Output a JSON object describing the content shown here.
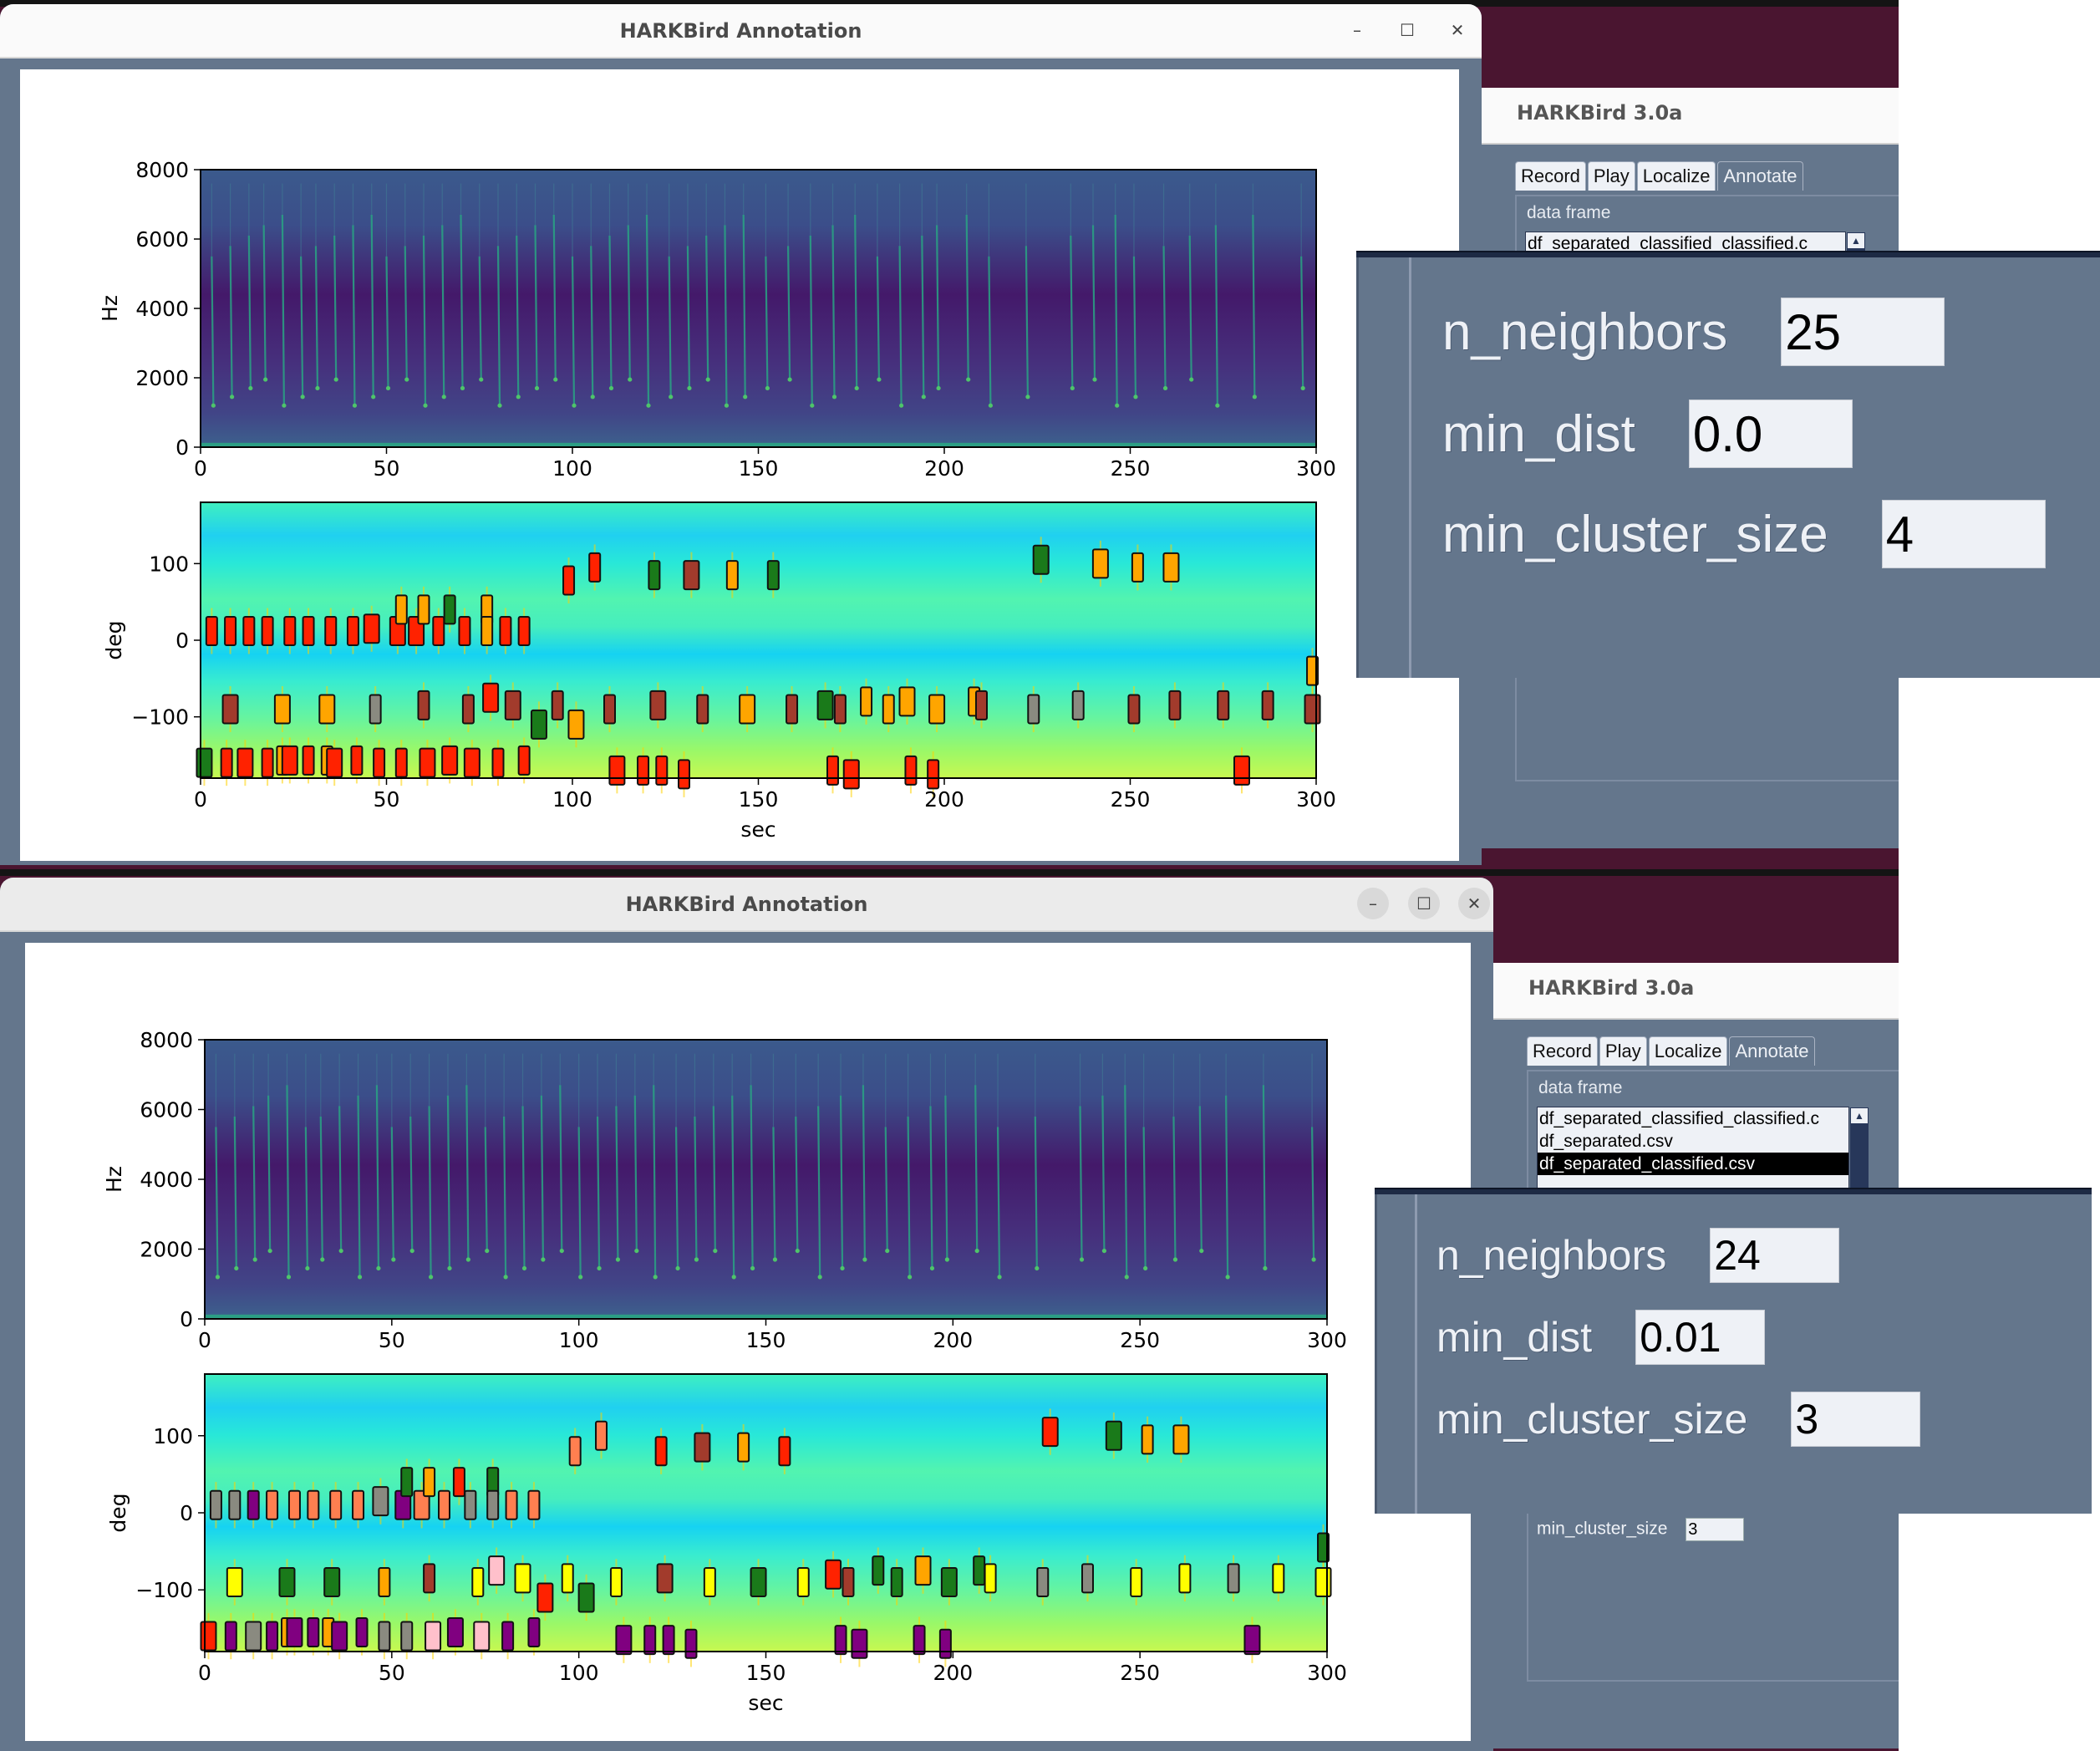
{
  "desktop": {
    "background": "#4a1530"
  },
  "windows": [
    {
      "title": "HARKBird Annotation",
      "controls": {
        "minimize": "–",
        "maximize": "☐",
        "close": "✕"
      }
    },
    {
      "title": "HARKBird Annotation",
      "controls": {
        "minimize": "–",
        "maximize": "☐",
        "close": "✕"
      }
    }
  ],
  "app_panels": [
    {
      "title": "HARKBird 3.0a",
      "tabs": [
        "Record",
        "Play",
        "Localize",
        "Annotate"
      ],
      "active_tab": "Annotate",
      "data_frame_label": "data frame",
      "data_frames": [
        "df_separated_classified_classified.c"
      ],
      "selected_data_frame": null
    },
    {
      "title": "HARKBird 3.0a",
      "tabs": [
        "Record",
        "Play",
        "Localize",
        "Annotate"
      ],
      "active_tab": "Annotate",
      "data_frame_label": "data frame",
      "data_frames": [
        "df_separated_classified_classified.c",
        "df_separated.csv",
        "df_separated_classified.csv"
      ],
      "selected_data_frame": "df_separated_classified.csv",
      "min_cluster_size_label": "min_cluster_size",
      "min_cluster_size_value": "3"
    }
  ],
  "parameter_overlays": [
    {
      "params": [
        {
          "label": "n_neighbors",
          "value": "25"
        },
        {
          "label": "min_dist",
          "value": "0.0"
        },
        {
          "label": "min_cluster_size",
          "value": "4"
        }
      ]
    },
    {
      "params": [
        {
          "label": "n_neighbors",
          "value": "24"
        },
        {
          "label": "min_dist",
          "value": "0.01"
        },
        {
          "label": "min_cluster_size",
          "value": "3"
        }
      ]
    }
  ],
  "colors": {
    "red": "#ff2200",
    "brown": "#a23b2c",
    "orange": "#ffa500",
    "green": "#1a7a1a",
    "gray": "#8a8a80",
    "purple": "#800080",
    "coral": "#ff7f50",
    "yellow": "#ffff00",
    "pink": "#ffc0cb"
  },
  "chart_data": [
    {
      "type": "heatmap",
      "title": "",
      "panel": "top-spectrogram",
      "xlabel": "",
      "ylabel": "Hz",
      "xlim": [
        0,
        300
      ],
      "ylim": [
        0,
        8000
      ],
      "xticks": [
        "0",
        "50",
        "100",
        "150",
        "200",
        "250",
        "300"
      ],
      "yticks": [
        "0",
        "2000",
        "4000",
        "6000",
        "8000"
      ],
      "colormap": "viridis",
      "call_times": [
        3,
        8,
        13,
        17,
        22,
        27,
        31,
        36,
        41,
        46,
        50,
        55,
        60,
        65,
        70,
        75,
        80,
        85,
        90,
        95,
        100,
        105,
        110,
        115,
        120,
        126,
        131,
        136,
        141,
        146,
        152,
        158,
        164,
        170,
        176,
        182,
        188,
        194,
        198,
        206,
        212,
        222,
        234,
        240,
        246,
        251,
        259,
        266,
        273,
        283,
        296
      ]
    },
    {
      "type": "scatter",
      "panel": "top-doa",
      "xlabel": "sec",
      "ylabel": "deg",
      "xlim": [
        0,
        300
      ],
      "ylim": [
        -180,
        180
      ],
      "xticks": [
        "0",
        "50",
        "100",
        "150",
        "200",
        "250",
        "300"
      ],
      "yticks": [
        "−100",
        "0",
        "100"
      ],
      "colormap": "jet",
      "points": [
        [
          1,
          -160,
          "green"
        ],
        [
          3,
          12,
          "red"
        ],
        [
          8,
          12,
          "red"
        ],
        [
          8,
          -90,
          "brown"
        ],
        [
          7,
          -160,
          "red"
        ],
        [
          13,
          12,
          "red"
        ],
        [
          12,
          -160,
          "red"
        ],
        [
          18,
          12,
          "red"
        ],
        [
          18,
          -160,
          "red"
        ],
        [
          22,
          -90,
          "orange"
        ],
        [
          22,
          -157,
          "orange"
        ],
        [
          24,
          12,
          "red"
        ],
        [
          24,
          -157,
          "red"
        ],
        [
          29,
          12,
          "red"
        ],
        [
          29,
          -157,
          "red"
        ],
        [
          34,
          -90,
          "orange"
        ],
        [
          34,
          -157,
          "orange"
        ],
        [
          35,
          12,
          "red"
        ],
        [
          36,
          -160,
          "red"
        ],
        [
          41,
          12,
          "red"
        ],
        [
          42,
          -157,
          "red"
        ],
        [
          46,
          15,
          "red"
        ],
        [
          47,
          -90,
          "gray"
        ],
        [
          48,
          -160,
          "red"
        ],
        [
          53,
          12,
          "red"
        ],
        [
          54,
          40,
          "orange"
        ],
        [
          54,
          -160,
          "red"
        ],
        [
          58,
          12,
          "red"
        ],
        [
          60,
          40,
          "orange"
        ],
        [
          60,
          -85,
          "brown"
        ],
        [
          61,
          -160,
          "red"
        ],
        [
          64,
          12,
          "red"
        ],
        [
          67,
          40,
          "green"
        ],
        [
          67,
          -157,
          "red"
        ],
        [
          71,
          12,
          "red"
        ],
        [
          72,
          -90,
          "brown"
        ],
        [
          73,
          -160,
          "red"
        ],
        [
          77,
          40,
          "orange"
        ],
        [
          77,
          12,
          "orange"
        ],
        [
          78,
          -75,
          "red"
        ],
        [
          80,
          -160,
          "red"
        ],
        [
          82,
          12,
          "red"
        ],
        [
          84,
          -85,
          "brown"
        ],
        [
          87,
          12,
          "red"
        ],
        [
          87,
          -157,
          "red"
        ],
        [
          91,
          -110,
          "green"
        ],
        [
          96,
          -85,
          "brown"
        ],
        [
          99,
          78,
          "red"
        ],
        [
          101,
          -110,
          "orange"
        ],
        [
          106,
          95,
          "red"
        ],
        [
          110,
          -90,
          "brown"
        ],
        [
          112,
          -170,
          "red"
        ],
        [
          119,
          -170,
          "red"
        ],
        [
          122,
          85,
          "green"
        ],
        [
          123,
          -85,
          "brown"
        ],
        [
          124,
          -170,
          "red"
        ],
        [
          130,
          -175,
          "red"
        ],
        [
          132,
          85,
          "brown"
        ],
        [
          135,
          -90,
          "brown"
        ],
        [
          143,
          85,
          "orange"
        ],
        [
          147,
          -90,
          "orange"
        ],
        [
          154,
          85,
          "green"
        ],
        [
          159,
          -90,
          "brown"
        ],
        [
          168,
          -85,
          "green"
        ],
        [
          170,
          -170,
          "red"
        ],
        [
          172,
          -90,
          "brown"
        ],
        [
          175,
          -175,
          "red"
        ],
        [
          179,
          -80,
          "orange"
        ],
        [
          185,
          -90,
          "orange"
        ],
        [
          190,
          -80,
          "orange"
        ],
        [
          191,
          -170,
          "red"
        ],
        [
          197,
          -175,
          "red"
        ],
        [
          198,
          -90,
          "orange"
        ],
        [
          208,
          -80,
          "orange"
        ],
        [
          210,
          -85,
          "brown"
        ],
        [
          226,
          105,
          "green"
        ],
        [
          224,
          -90,
          "gray"
        ],
        [
          236,
          -85,
          "gray"
        ],
        [
          242,
          100,
          "orange"
        ],
        [
          251,
          -90,
          "brown"
        ],
        [
          252,
          95,
          "orange"
        ],
        [
          261,
          95,
          "orange"
        ],
        [
          262,
          -85,
          "brown"
        ],
        [
          275,
          -85,
          "brown"
        ],
        [
          280,
          -170,
          "red"
        ],
        [
          287,
          -85,
          "brown"
        ],
        [
          299,
          -40,
          "orange"
        ],
        [
          299,
          -90,
          "brown"
        ]
      ]
    },
    {
      "type": "heatmap",
      "panel": "bottom-spectrogram",
      "xlabel": "",
      "ylabel": "Hz",
      "xlim": [
        0,
        300
      ],
      "ylim": [
        0,
        8000
      ],
      "xticks": [
        "0",
        "50",
        "100",
        "150",
        "200",
        "250",
        "300"
      ],
      "yticks": [
        "0",
        "2000",
        "4000",
        "6000",
        "8000"
      ],
      "colormap": "viridis",
      "call_times": [
        3,
        8,
        13,
        17,
        22,
        27,
        31,
        36,
        41,
        46,
        50,
        55,
        60,
        65,
        70,
        75,
        80,
        85,
        90,
        95,
        100,
        105,
        110,
        115,
        120,
        126,
        131,
        136,
        141,
        146,
        152,
        158,
        164,
        170,
        176,
        182,
        188,
        194,
        198,
        206,
        212,
        222,
        234,
        240,
        246,
        251,
        259,
        266,
        273,
        283,
        296
      ]
    },
    {
      "type": "scatter",
      "panel": "bottom-doa",
      "xlabel": "sec",
      "ylabel": "deg",
      "xlim": [
        0,
        300
      ],
      "ylim": [
        -180,
        180
      ],
      "xticks": [
        "0",
        "50",
        "100",
        "150",
        "200",
        "250",
        "300"
      ],
      "yticks": [
        "−100",
        "0",
        "100"
      ],
      "colormap": "jet",
      "points": [
        [
          1,
          -160,
          "red"
        ],
        [
          3,
          10,
          "gray"
        ],
        [
          8,
          10,
          "gray"
        ],
        [
          8,
          -90,
          "yellow"
        ],
        [
          7,
          -160,
          "purple"
        ],
        [
          13,
          10,
          "purple"
        ],
        [
          13,
          -160,
          "gray"
        ],
        [
          18,
          10,
          "coral"
        ],
        [
          18,
          -160,
          "purple"
        ],
        [
          22,
          -90,
          "green"
        ],
        [
          22,
          -155,
          "orange"
        ],
        [
          24,
          10,
          "coral"
        ],
        [
          24,
          -155,
          "purple"
        ],
        [
          29,
          10,
          "coral"
        ],
        [
          29,
          -155,
          "purple"
        ],
        [
          34,
          -90,
          "green"
        ],
        [
          33,
          -155,
          "orange"
        ],
        [
          35,
          10,
          "coral"
        ],
        [
          36,
          -160,
          "purple"
        ],
        [
          41,
          10,
          "coral"
        ],
        [
          42,
          -155,
          "purple"
        ],
        [
          47,
          15,
          "gray"
        ],
        [
          48,
          -90,
          "orange"
        ],
        [
          48,
          -160,
          "gray"
        ],
        [
          53,
          10,
          "purple"
        ],
        [
          54,
          40,
          "green"
        ],
        [
          54,
          -160,
          "gray"
        ],
        [
          58,
          10,
          "coral"
        ],
        [
          60,
          40,
          "orange"
        ],
        [
          60,
          -85,
          "brown"
        ],
        [
          61,
          -160,
          "pink"
        ],
        [
          64,
          10,
          "coral"
        ],
        [
          68,
          40,
          "red"
        ],
        [
          67,
          -155,
          "purple"
        ],
        [
          71,
          10,
          "gray"
        ],
        [
          73,
          -90,
          "yellow"
        ],
        [
          74,
          -160,
          "pink"
        ],
        [
          77,
          40,
          "green"
        ],
        [
          77,
          10,
          "gray"
        ],
        [
          78,
          -75,
          "pink"
        ],
        [
          81,
          -160,
          "purple"
        ],
        [
          82,
          10,
          "coral"
        ],
        [
          85,
          -85,
          "yellow"
        ],
        [
          88,
          10,
          "coral"
        ],
        [
          88,
          -155,
          "purple"
        ],
        [
          91,
          -110,
          "red"
        ],
        [
          97,
          -85,
          "yellow"
        ],
        [
          99,
          80,
          "coral"
        ],
        [
          102,
          -110,
          "green"
        ],
        [
          106,
          100,
          "coral"
        ],
        [
          110,
          -90,
          "yellow"
        ],
        [
          112,
          -165,
          "purple"
        ],
        [
          119,
          -165,
          "purple"
        ],
        [
          122,
          80,
          "red"
        ],
        [
          123,
          -85,
          "brown"
        ],
        [
          124,
          -165,
          "purple"
        ],
        [
          130,
          -170,
          "purple"
        ],
        [
          133,
          85,
          "brown"
        ],
        [
          135,
          -90,
          "yellow"
        ],
        [
          144,
          85,
          "orange"
        ],
        [
          148,
          -90,
          "green"
        ],
        [
          155,
          80,
          "red"
        ],
        [
          160,
          -90,
          "yellow"
        ],
        [
          168,
          -80,
          "red"
        ],
        [
          170,
          -165,
          "purple"
        ],
        [
          172,
          -90,
          "brown"
        ],
        [
          175,
          -170,
          "purple"
        ],
        [
          180,
          -75,
          "green"
        ],
        [
          185,
          -90,
          "green"
        ],
        [
          192,
          -75,
          "orange"
        ],
        [
          191,
          -165,
          "purple"
        ],
        [
          198,
          -170,
          "purple"
        ],
        [
          199,
          -90,
          "green"
        ],
        [
          207,
          -75,
          "green"
        ],
        [
          210,
          -85,
          "yellow"
        ],
        [
          226,
          105,
          "red"
        ],
        [
          224,
          -90,
          "gray"
        ],
        [
          236,
          -85,
          "gray"
        ],
        [
          243,
          100,
          "green"
        ],
        [
          249,
          -90,
          "yellow"
        ],
        [
          252,
          95,
          "orange"
        ],
        [
          261,
          95,
          "orange"
        ],
        [
          262,
          -85,
          "yellow"
        ],
        [
          275,
          -85,
          "gray"
        ],
        [
          280,
          -165,
          "purple"
        ],
        [
          287,
          -85,
          "yellow"
        ],
        [
          299,
          -45,
          "green"
        ],
        [
          299,
          -90,
          "yellow"
        ]
      ]
    }
  ]
}
